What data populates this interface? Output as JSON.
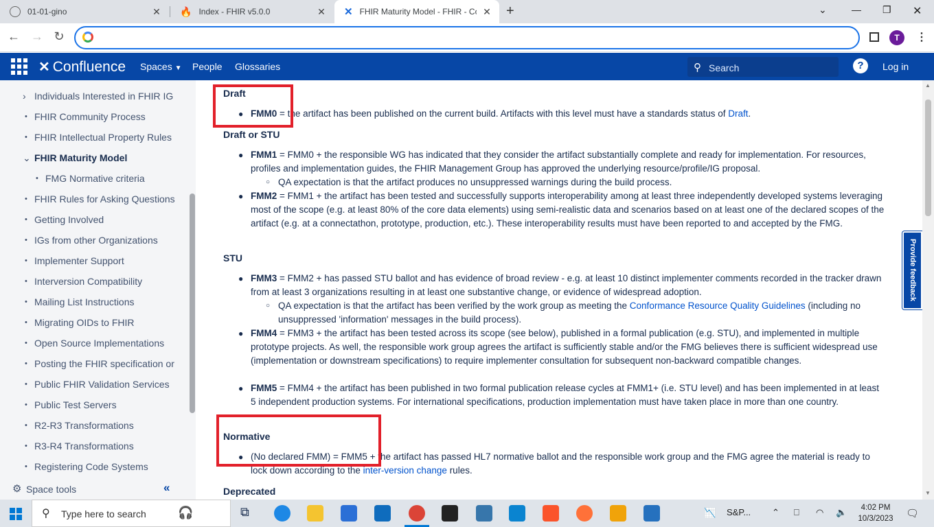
{
  "browser": {
    "tabs": [
      {
        "title": "01-01-gino"
      },
      {
        "title": "Index - FHIR v5.0.0"
      },
      {
        "title": "FHIR Maturity Model - FHIR - Co"
      }
    ],
    "address": "",
    "avatar_letter": "T"
  },
  "header": {
    "brand": "Confluence",
    "nav": [
      "Spaces",
      "People",
      "Glossaries"
    ],
    "search_placeholder": "Search",
    "login": "Log in",
    "help": "?"
  },
  "sidebar": {
    "items": [
      {
        "label": "Individuals Interested in FHIR IG",
        "kind": "collapsed"
      },
      {
        "label": "FHIR Community Process",
        "kind": "bullet"
      },
      {
        "label": "FHIR Intellectual Property Rules",
        "kind": "bullet"
      },
      {
        "label": "FHIR Maturity Model",
        "kind": "expanded"
      },
      {
        "label": "FMG Normative criteria",
        "kind": "child"
      },
      {
        "label": "FHIR Rules for Asking Questions",
        "kind": "bullet"
      },
      {
        "label": "Getting Involved",
        "kind": "bullet"
      },
      {
        "label": "IGs from other Organizations",
        "kind": "bullet"
      },
      {
        "label": "Implementer Support",
        "kind": "bullet"
      },
      {
        "label": "Interversion Compatibility",
        "kind": "bullet"
      },
      {
        "label": "Mailing List Instructions",
        "kind": "bullet"
      },
      {
        "label": "Migrating OIDs to FHIR",
        "kind": "bullet"
      },
      {
        "label": "Open Source Implementations",
        "kind": "bullet"
      },
      {
        "label": "Posting the FHIR specification or",
        "kind": "bullet"
      },
      {
        "label": "Public FHIR Validation Services",
        "kind": "bullet"
      },
      {
        "label": "Public Test Servers",
        "kind": "bullet"
      },
      {
        "label": "R2-R3 Transformations",
        "kind": "bullet"
      },
      {
        "label": "R3-R4 Transformations",
        "kind": "bullet"
      },
      {
        "label": "Registering Code Systems",
        "kind": "bullet"
      }
    ],
    "space_tools": "Space tools"
  },
  "content": {
    "draft": {
      "heading": "Draft",
      "fmm0_term": "FMM0",
      "fmm0_text": " = the artifact has been published on the current build. Artifacts with this level must have a standards status of ",
      "fmm0_link": "Draft",
      "fmm0_end": "."
    },
    "draft_stu": {
      "heading": "Draft or STU",
      "fmm1_term": "FMM1",
      "fmm1_text": " = FMM0 + the responsible WG has indicated that they consider the artifact substantially complete and ready for implementation. For resources, profiles and implementation guides, the FHIR Management Group has approved the underlying resource/profile/IG proposal.",
      "fmm1_sub": "QA expectation is that the artifact produces no unsuppressed warnings during the build process.",
      "fmm2_term": "FMM2",
      "fmm2_text": " = FMM1 + the artifact has been tested and successfully supports interoperability among at least three independently developed systems leveraging most of the scope (e.g. at least 80% of the core data elements) using semi-realistic data and scenarios based on at least one of the declared scopes of the artifact (e.g. at a connectathon, prototype, production, etc.). These interoperability results must have been reported to and accepted by the FMG."
    },
    "stu": {
      "heading": "STU",
      "fmm3_term": "FMM3",
      "fmm3_text": " = FMM2 + has passed STU ballot and has evidence of broad review - e.g. at least 10 distinct implementer comments recorded in the tracker drawn from at least 3 organizations resulting in at least one substantive change, or evidence of widespread adoption.",
      "fmm3_sub_a": "QA expectation is that the artifact has been verified by the work group as meeting the ",
      "fmm3_sub_link": "Conformance Resource Quality Guidelines",
      "fmm3_sub_b": " (including no unsuppressed 'information' messages in the build process).",
      "fmm4_term": "FMM4",
      "fmm4_text": " = FMM3 + the artifact has been tested across its scope (see below), published in a formal publication (e.g. STU), and implemented in multiple prototype projects. As well, the responsible work group agrees the artifact is sufficiently stable and/or the FMG believes there is sufficient widespread use (implementation or downstream specifications) to require implementer consultation for subsequent non-backward compatible changes.",
      "fmm5_term": "FMM5",
      "fmm5_text": " = FMM4 + the artifact has been published in two formal publication release cycles at FMM1+ (i.e. STU level) and has been implemented in at least 5 independent production systems.  For international specifications, production implementation must have taken place in more than one country."
    },
    "normative": {
      "heading": "Normative",
      "text_a": "(No declared FMM) = FMM5 + the artifact has passed HL7 normative ballot and the responsible work group and the FMG agree the material is ready to lock down according to the ",
      "link": "inter-version change",
      "text_b": " rules."
    },
    "deprecated": {
      "heading": "Deprecated"
    }
  },
  "feedback": "Provide feedback",
  "taskbar": {
    "search_placeholder": "Type here to search",
    "tray_label": "S&P...",
    "time": "4:02 PM",
    "date": "10/3/2023"
  },
  "colors": {
    "header_bg": "#0747a6",
    "highlight_box": "#e2202a",
    "link": "#0052cc"
  }
}
